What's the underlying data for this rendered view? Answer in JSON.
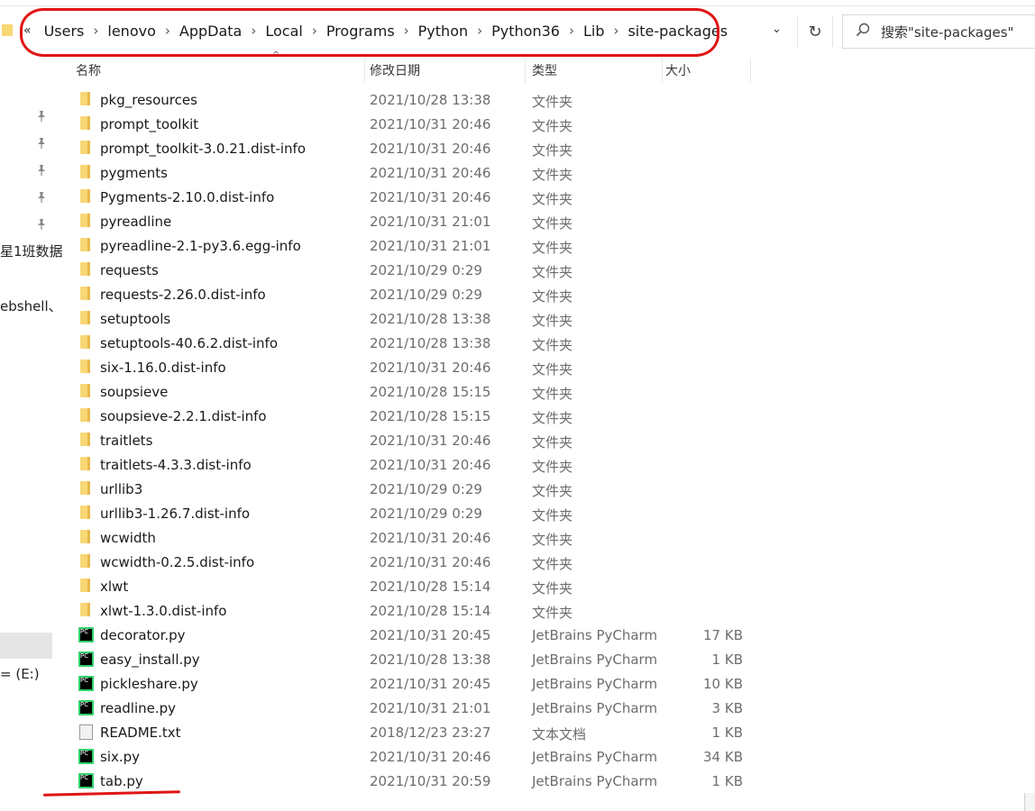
{
  "address": {
    "overflow_chevron": "«",
    "crumbs": [
      "Users",
      "lenovo",
      "AppData",
      "Local",
      "Programs",
      "Python",
      "Python36",
      "Lib",
      "site-packages"
    ],
    "separator": "›",
    "dropdown": "⌄",
    "refresh": "↻"
  },
  "search": {
    "icon": "search-icon",
    "placeholder": "搜索\"site-packages\""
  },
  "columns": {
    "name": "名称",
    "date": "修改日期",
    "type": "类型",
    "size": "大小",
    "sort_indicator": "^"
  },
  "nav": {
    "pins": 5,
    "items": [
      {
        "text": "星1班数据"
      },
      {
        "text": "ebshell、"
      },
      {
        "text": "= (E:)"
      }
    ]
  },
  "files": [
    {
      "name": "pkg_resources",
      "date": "2021/10/28 13:38",
      "type": "文件夹",
      "size": "",
      "icon": "folder"
    },
    {
      "name": "prompt_toolkit",
      "date": "2021/10/31 20:46",
      "type": "文件夹",
      "size": "",
      "icon": "folder"
    },
    {
      "name": "prompt_toolkit-3.0.21.dist-info",
      "date": "2021/10/31 20:46",
      "type": "文件夹",
      "size": "",
      "icon": "folder"
    },
    {
      "name": "pygments",
      "date": "2021/10/31 20:46",
      "type": "文件夹",
      "size": "",
      "icon": "folder"
    },
    {
      "name": "Pygments-2.10.0.dist-info",
      "date": "2021/10/31 20:46",
      "type": "文件夹",
      "size": "",
      "icon": "folder"
    },
    {
      "name": "pyreadline",
      "date": "2021/10/31 21:01",
      "type": "文件夹",
      "size": "",
      "icon": "folder"
    },
    {
      "name": "pyreadline-2.1-py3.6.egg-info",
      "date": "2021/10/31 21:01",
      "type": "文件夹",
      "size": "",
      "icon": "folder"
    },
    {
      "name": "requests",
      "date": "2021/10/29 0:29",
      "type": "文件夹",
      "size": "",
      "icon": "folder"
    },
    {
      "name": "requests-2.26.0.dist-info",
      "date": "2021/10/29 0:29",
      "type": "文件夹",
      "size": "",
      "icon": "folder"
    },
    {
      "name": "setuptools",
      "date": "2021/10/28 13:38",
      "type": "文件夹",
      "size": "",
      "icon": "folder"
    },
    {
      "name": "setuptools-40.6.2.dist-info",
      "date": "2021/10/28 13:38",
      "type": "文件夹",
      "size": "",
      "icon": "folder"
    },
    {
      "name": "six-1.16.0.dist-info",
      "date": "2021/10/31 20:46",
      "type": "文件夹",
      "size": "",
      "icon": "folder"
    },
    {
      "name": "soupsieve",
      "date": "2021/10/28 15:15",
      "type": "文件夹",
      "size": "",
      "icon": "folder"
    },
    {
      "name": "soupsieve-2.2.1.dist-info",
      "date": "2021/10/28 15:15",
      "type": "文件夹",
      "size": "",
      "icon": "folder"
    },
    {
      "name": "traitlets",
      "date": "2021/10/31 20:46",
      "type": "文件夹",
      "size": "",
      "icon": "folder"
    },
    {
      "name": "traitlets-4.3.3.dist-info",
      "date": "2021/10/31 20:46",
      "type": "文件夹",
      "size": "",
      "icon": "folder"
    },
    {
      "name": "urllib3",
      "date": "2021/10/29 0:29",
      "type": "文件夹",
      "size": "",
      "icon": "folder"
    },
    {
      "name": "urllib3-1.26.7.dist-info",
      "date": "2021/10/29 0:29",
      "type": "文件夹",
      "size": "",
      "icon": "folder"
    },
    {
      "name": "wcwidth",
      "date": "2021/10/31 20:46",
      "type": "文件夹",
      "size": "",
      "icon": "folder"
    },
    {
      "name": "wcwidth-0.2.5.dist-info",
      "date": "2021/10/31 20:46",
      "type": "文件夹",
      "size": "",
      "icon": "folder"
    },
    {
      "name": "xlwt",
      "date": "2021/10/28 15:14",
      "type": "文件夹",
      "size": "",
      "icon": "folder"
    },
    {
      "name": "xlwt-1.3.0.dist-info",
      "date": "2021/10/28 15:14",
      "type": "文件夹",
      "size": "",
      "icon": "folder"
    },
    {
      "name": "decorator.py",
      "date": "2021/10/31 20:45",
      "type": "JetBrains PyCharm",
      "size": "17 KB",
      "icon": "pycharm"
    },
    {
      "name": "easy_install.py",
      "date": "2021/10/28 13:38",
      "type": "JetBrains PyCharm",
      "size": "1 KB",
      "icon": "pycharm"
    },
    {
      "name": "pickleshare.py",
      "date": "2021/10/31 20:45",
      "type": "JetBrains PyCharm",
      "size": "10 KB",
      "icon": "pycharm"
    },
    {
      "name": "readline.py",
      "date": "2021/10/31 21:01",
      "type": "JetBrains PyCharm",
      "size": "3 KB",
      "icon": "pycharm"
    },
    {
      "name": "README.txt",
      "date": "2018/12/23 23:27",
      "type": "文本文档",
      "size": "1 KB",
      "icon": "text"
    },
    {
      "name": "six.py",
      "date": "2021/10/31 20:46",
      "type": "JetBrains PyCharm",
      "size": "34 KB",
      "icon": "pycharm"
    },
    {
      "name": "tab.py",
      "date": "2021/10/31 20:59",
      "type": "JetBrains PyCharm",
      "size": "1 KB",
      "icon": "pycharm"
    }
  ],
  "colors": {
    "annotation_red": "#e01414",
    "folder_yellow": "#f8d775",
    "meta_gray": "#6d6d6d"
  }
}
